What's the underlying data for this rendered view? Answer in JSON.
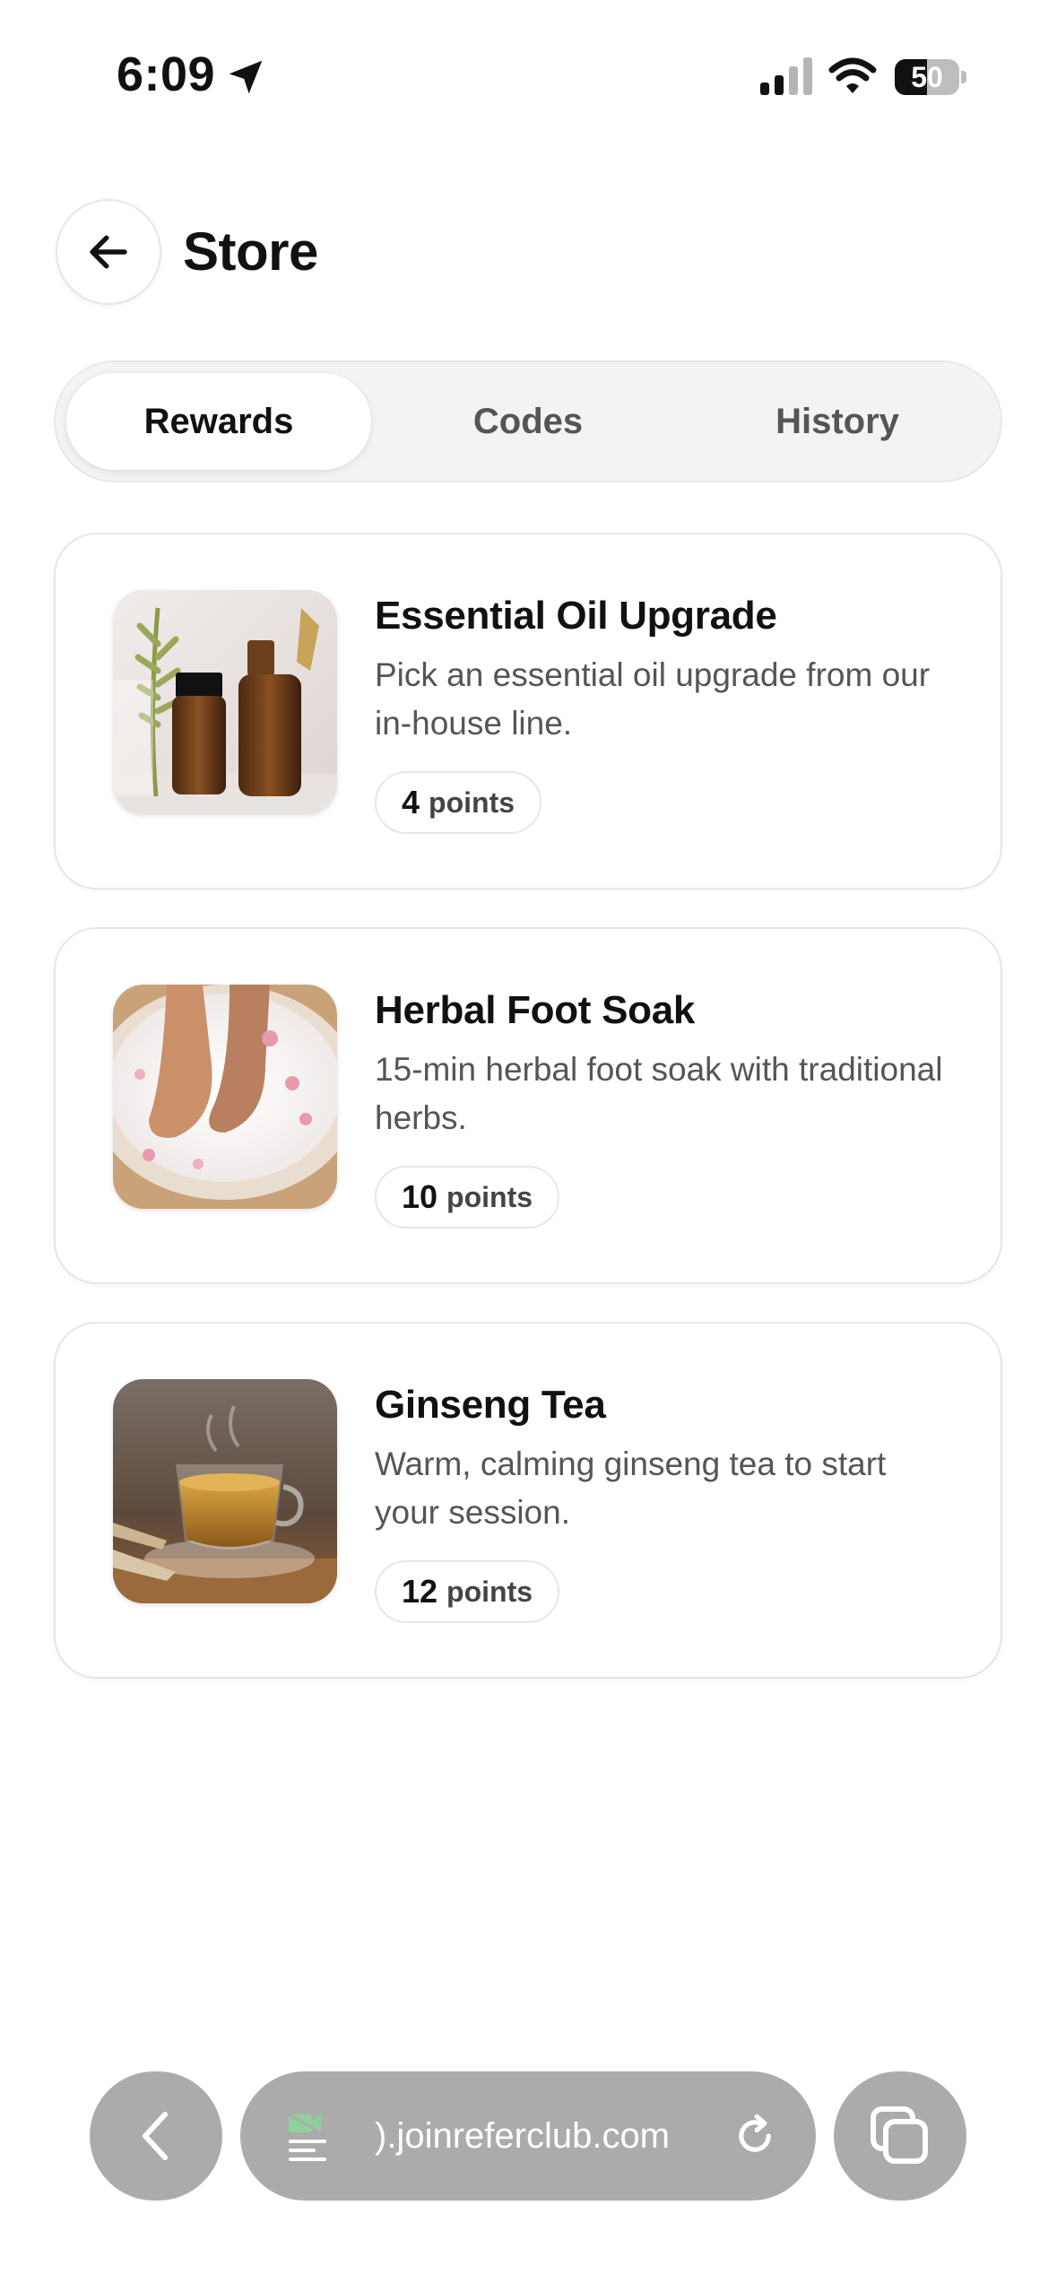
{
  "status_bar": {
    "time": "6:09",
    "battery_percent": "50",
    "battery_level": 0.5,
    "icons": [
      "location-arrow-icon",
      "cellular-signal-icon",
      "wifi-icon",
      "battery-icon"
    ]
  },
  "header": {
    "back_icon": "arrow-left-icon",
    "title": "Store"
  },
  "tabs": [
    {
      "label": "Rewards",
      "active": true
    },
    {
      "label": "Codes",
      "active": false
    },
    {
      "label": "History",
      "active": false
    }
  ],
  "rewards": [
    {
      "title": "Essential Oil Upgrade",
      "description": "Pick an essential oil upgrade from our in-house line.",
      "points": "4",
      "points_unit": "points",
      "image": "essential-oil-bottles"
    },
    {
      "title": "Herbal Foot Soak",
      "description": "15-min herbal foot soak with traditional herbs.",
      "points": "10",
      "points_unit": "points",
      "image": "feet-in-flower-bath"
    },
    {
      "title": "Ginseng Tea",
      "description": "Warm, calming ginseng tea to start your session.",
      "points": "12",
      "points_unit": "points",
      "image": "tea-cup-with-ginseng"
    }
  ],
  "browser_bar": {
    "url": ").joinreferclub.com",
    "icons": [
      "chevron-left-icon",
      "site-settings-icon",
      "reload-icon",
      "tabs-icon"
    ]
  },
  "colors": {
    "background": "#ffffff",
    "text_primary": "#111111",
    "text_secondary": "#555555",
    "border": "#e6e6e6",
    "tab_track": "#f3f3f3",
    "browser_controls": "#ababab"
  }
}
